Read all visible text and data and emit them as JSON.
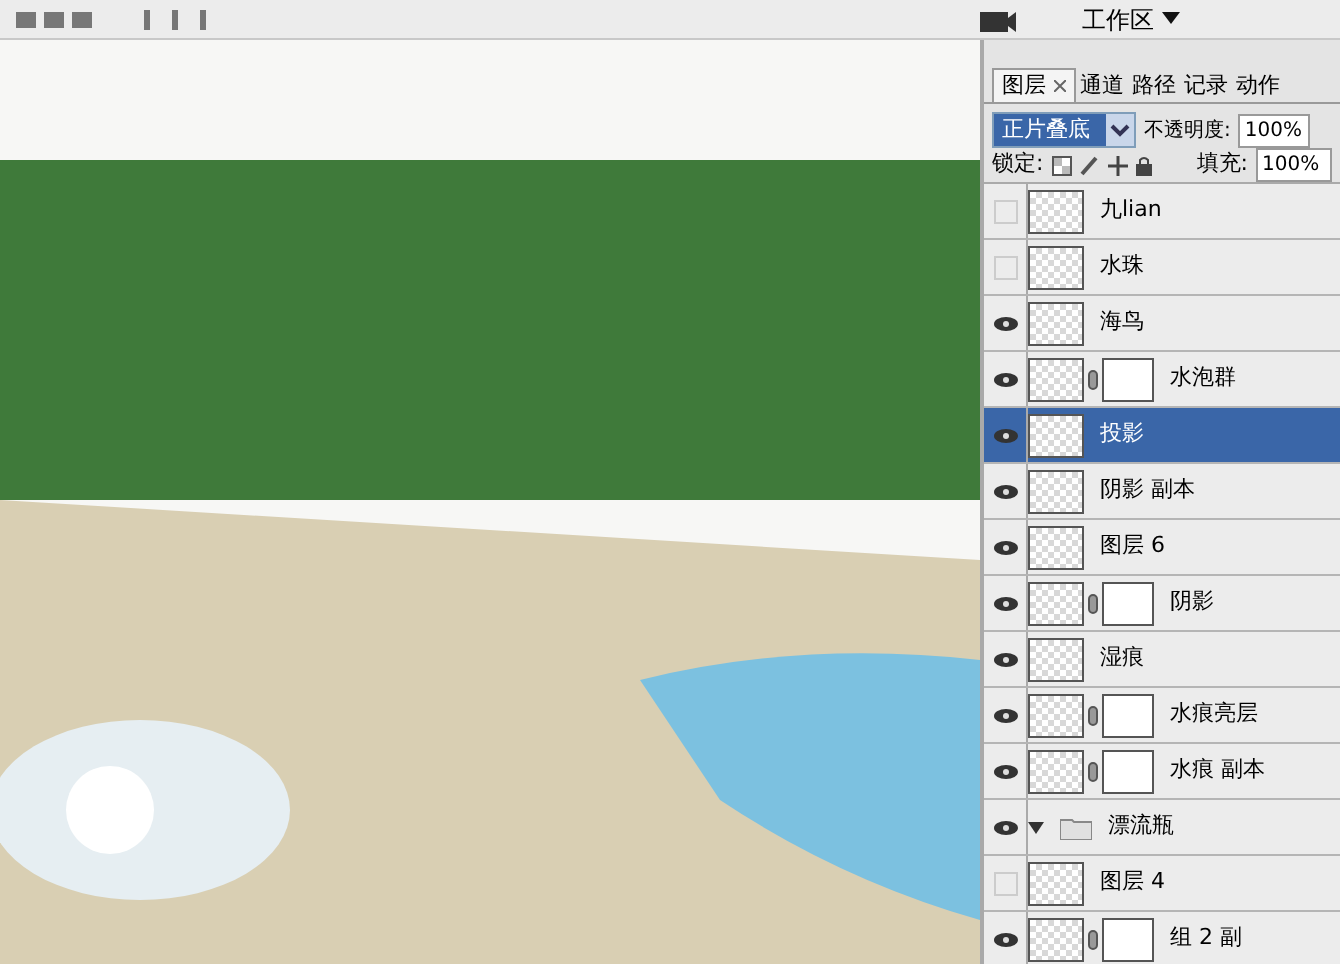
{
  "toolbar": {
    "workspace_button": "工作区"
  },
  "layers_panel": {
    "tabs": [
      {
        "label": "图层",
        "selected": true,
        "closable": true
      },
      {
        "label": "通道",
        "selected": false,
        "closable": false
      },
      {
        "label": "路径",
        "selected": false,
        "closable": false
      },
      {
        "label": "记录",
        "selected": false,
        "closable": false
      },
      {
        "label": "动作",
        "selected": false,
        "closable": false
      }
    ],
    "blend_mode": "正片叠底",
    "opacity_label": "不透明度:",
    "opacity": "100%",
    "lock_label": "锁定:",
    "fill_label": "填充:",
    "fill": "100%",
    "layers": [
      {
        "kind": "layer",
        "name": "九lian",
        "visible": false,
        "selected": false,
        "mask": false
      },
      {
        "kind": "layer",
        "name": "水珠",
        "visible": false,
        "selected": false,
        "mask": false
      },
      {
        "kind": "layer",
        "name": "海鸟",
        "visible": true,
        "selected": false,
        "mask": false
      },
      {
        "kind": "layer",
        "name": "水泡群",
        "visible": true,
        "selected": false,
        "mask": true
      },
      {
        "kind": "layer",
        "name": "投影",
        "visible": true,
        "selected": true,
        "mask": false
      },
      {
        "kind": "layer",
        "name": "阴影 副本",
        "visible": true,
        "selected": false,
        "mask": false
      },
      {
        "kind": "layer",
        "name": "图层 6",
        "visible": true,
        "selected": false,
        "mask": false
      },
      {
        "kind": "layer",
        "name": "阴影",
        "visible": true,
        "selected": false,
        "mask": true
      },
      {
        "kind": "layer",
        "name": "湿痕",
        "visible": true,
        "selected": false,
        "mask": false
      },
      {
        "kind": "layer",
        "name": "水痕亮层",
        "visible": true,
        "selected": false,
        "mask": true
      },
      {
        "kind": "layer",
        "name": "水痕 副本",
        "visible": true,
        "selected": false,
        "mask": true
      },
      {
        "kind": "group",
        "name": "漂流瓶",
        "visible": true,
        "selected": false,
        "expanded": true,
        "children": [
          {
            "kind": "layer",
            "name": "图层 4",
            "visible": false,
            "selected": false,
            "mask": false
          },
          {
            "kind": "layer",
            "name": "组 2 副",
            "visible": true,
            "selected": false,
            "mask": true
          }
        ]
      }
    ]
  }
}
